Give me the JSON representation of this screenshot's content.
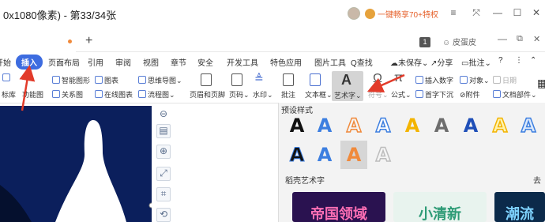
{
  "window": {
    "title": "0x1080像素) - 第33/34张",
    "promo": "一键畅享70+特权"
  },
  "tabstrip": {
    "share_label": "皮蛋皮"
  },
  "ribbon_tabs": [
    {
      "label": "开始"
    },
    {
      "label": "插入"
    },
    {
      "label": "页面布局"
    },
    {
      "label": "引用"
    },
    {
      "label": "审阅"
    },
    {
      "label": "视图"
    },
    {
      "label": "章节"
    },
    {
      "label": "安全"
    },
    {
      "label": "开发工具"
    },
    {
      "label": "特色应用"
    },
    {
      "label": "图片工具"
    },
    {
      "label": "Q查找"
    },
    {
      "label": "未保存"
    },
    {
      "label": "分享"
    },
    {
      "label": "批注"
    }
  ],
  "ribbon": {
    "smart_art": "智能图形",
    "chart": "图表",
    "mindmap": "思维导图",
    "relation": "关系图",
    "online_chart": "在线图表",
    "flowchart": "流程图",
    "header_footer": "页眉和页脚",
    "page_number": "页码",
    "watermark": "水印",
    "comment": "批注",
    "textbox": "文本框",
    "wordart": "艺术字",
    "symbol": "符号",
    "formula": "公式",
    "insert_number": "插入数字",
    "drop_cap": "首字下沉",
    "object": "对象",
    "date": "日期",
    "attachment": "附件",
    "doc_parts": "文档部件",
    "left_cut1": "标库",
    "left_cut2": "功能图"
  },
  "panel": {
    "preset_title": "预设样式",
    "section_title": "稻壳艺术字",
    "more_label": "去",
    "glyph": "A",
    "thumb1_text": "帝国领域",
    "thumb2_text": "小清新",
    "thumb3_text": "潮流"
  },
  "colors": {
    "accent": "#3d6ce0",
    "arrow": "#e23b2a"
  }
}
